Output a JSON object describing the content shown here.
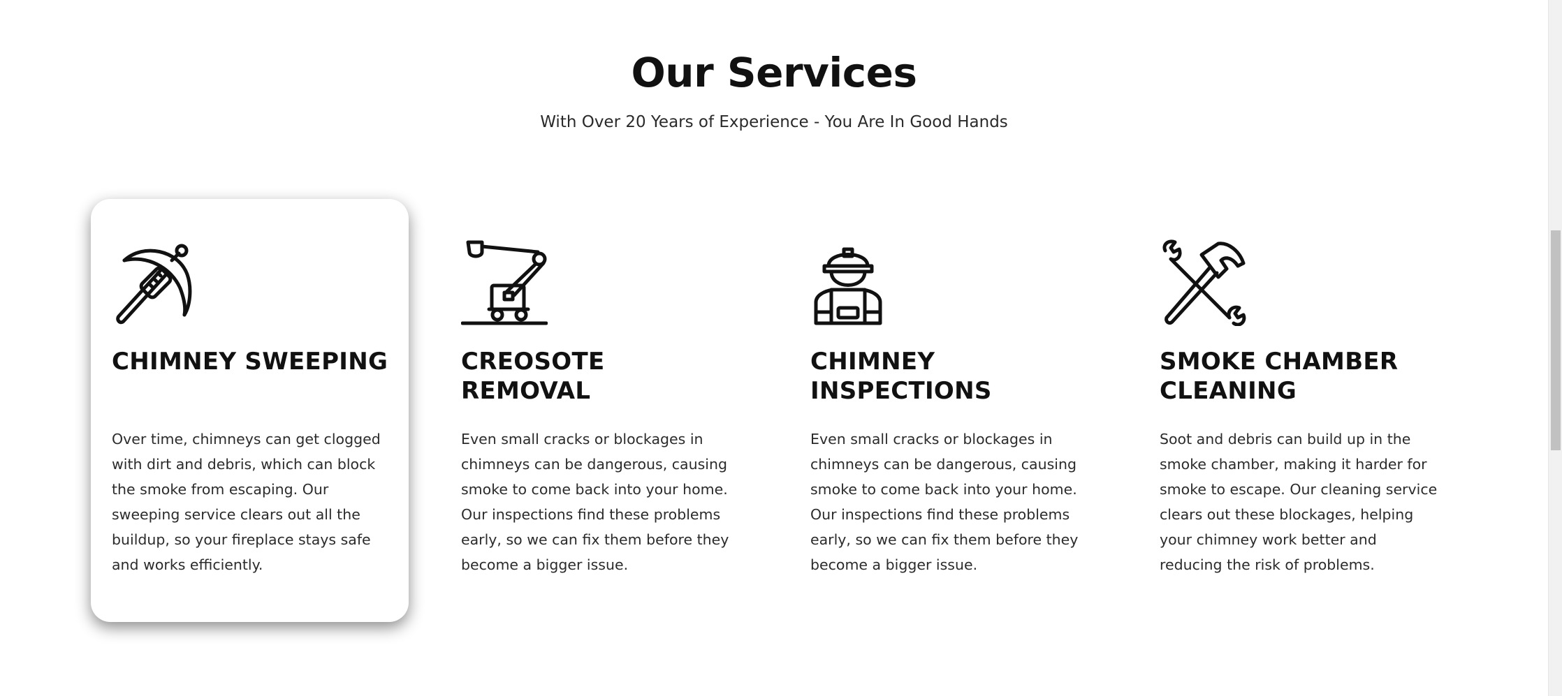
{
  "section": {
    "title": "Our Services",
    "subtitle": "With Over 20 Years of Experience - You Are In Good Hands"
  },
  "services": [
    {
      "icon": "pickaxe-icon",
      "title": "CHIMNEY SWEEPING",
      "description": "Over time, chimneys can get clogged with dirt and debris, which can block the smoke from escaping. Our sweeping service clears out all the buildup, so your fireplace stays safe and works efficiently."
    },
    {
      "icon": "lift-machine-icon",
      "title": "CREOSOTE REMOVAL",
      "description": "Even small cracks or blockages in chimneys can be dangerous, causing smoke to come back into your home. Our inspections find these problems early, so we can fix them before they become a bigger issue."
    },
    {
      "icon": "worker-icon",
      "title": "CHIMNEY INSPECTIONS",
      "description": "Even small cracks or blockages in chimneys can be dangerous, causing smoke to come back into your home. Our inspections find these problems early, so we can fix them before they become a bigger issue."
    },
    {
      "icon": "hammer-wrench-icon",
      "title": "SMOKE CHAMBER CLEANING",
      "description": "Soot and debris can build up in the smoke chamber, making it harder for smoke to escape. Our cleaning service clears out these blockages, helping your chimney work better and reducing the risk of problems."
    }
  ]
}
